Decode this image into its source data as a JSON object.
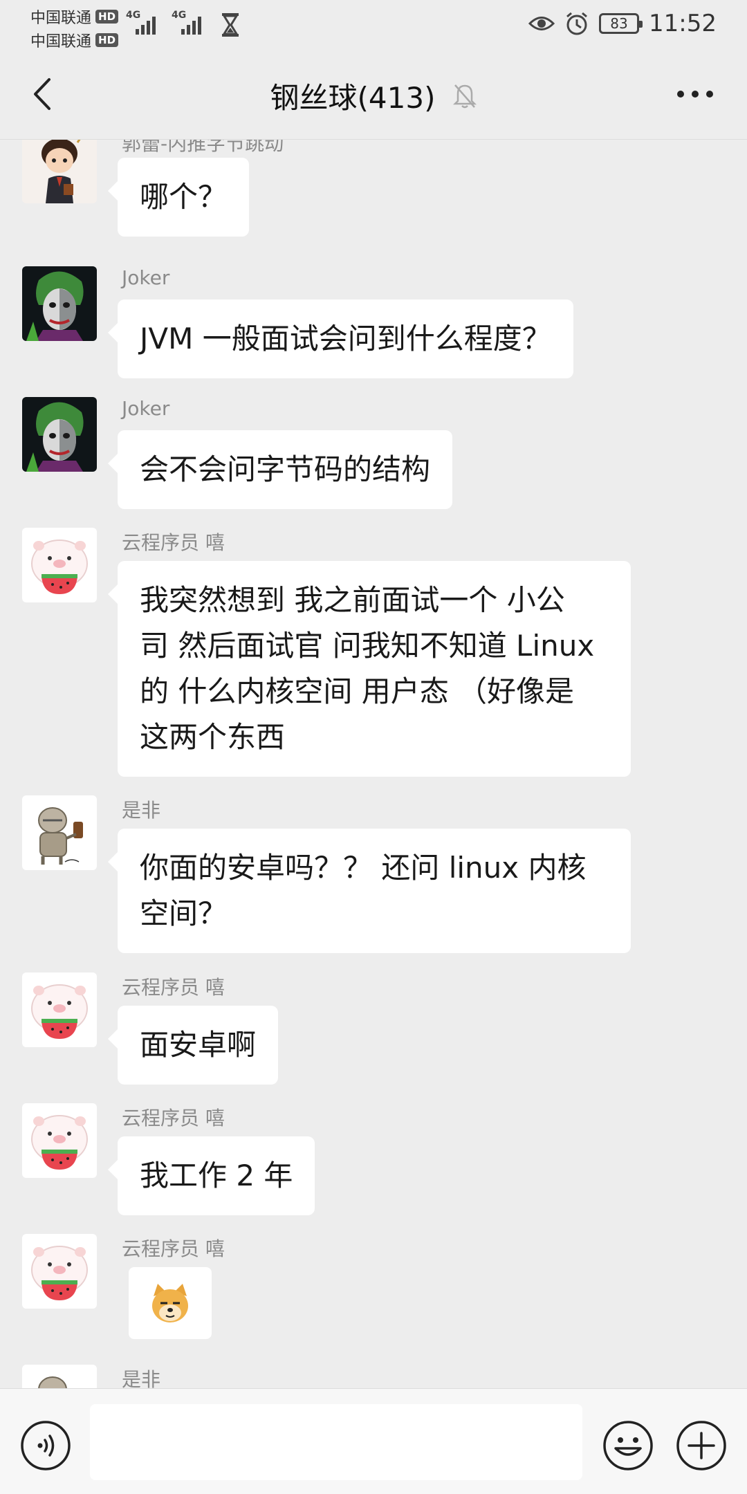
{
  "status_bar": {
    "carrier1": "中国联通",
    "carrier2": "中国联通",
    "hd_badge": "HD",
    "network_label": "4G",
    "battery": "83",
    "time": "11:52",
    "icons": [
      "signal-icon",
      "hourglass-icon",
      "eye-icon",
      "alarm-icon",
      "battery-icon"
    ]
  },
  "header": {
    "title": "钢丝球(413)",
    "icons": [
      "back-icon",
      "mute-bell-icon",
      "more-icon"
    ]
  },
  "messages": [
    {
      "sender": "郭蕾-内推字节跳动",
      "text": "哪个？",
      "avatar": "cartoon-boy-avatar"
    },
    {
      "sender": "Joker",
      "text": "JVM 一般面试会问到什么程度？",
      "avatar": "joker-avatar"
    },
    {
      "sender": "Joker",
      "text": "会不会问字节码的结构",
      "avatar": "joker-avatar"
    },
    {
      "sender": "云程序员 嘻",
      "lines": [
        "我突然想到 我之前面试一个 小公",
        "司 然后面试官 问我知不知道 Linux",
        "的 什么内核空间 用户态 （好像是",
        "这两个东西"
      ],
      "avatar": "piggy-watermelon-avatar"
    },
    {
      "sender": "是非",
      "lines": [
        "你面的安卓吗？？ 还问 linux 内核",
        "空间？"
      ],
      "avatar": "knight-avatar"
    },
    {
      "sender": "云程序员 嘻",
      "text": "面安卓啊",
      "avatar": "piggy-watermelon-avatar"
    },
    {
      "sender": "云程序员 嘻",
      "text": "我工作 2 年",
      "avatar": "piggy-watermelon-avatar"
    },
    {
      "sender": "云程序员 嘻",
      "sticker": "doge-sticker-icon",
      "avatar": "piggy-watermelon-avatar"
    },
    {
      "sender": "是非",
      "avatar": "knight-avatar"
    }
  ],
  "input_bar": {
    "value": "",
    "icons": [
      "voice-icon",
      "emoji-icon",
      "plus-icon"
    ]
  }
}
